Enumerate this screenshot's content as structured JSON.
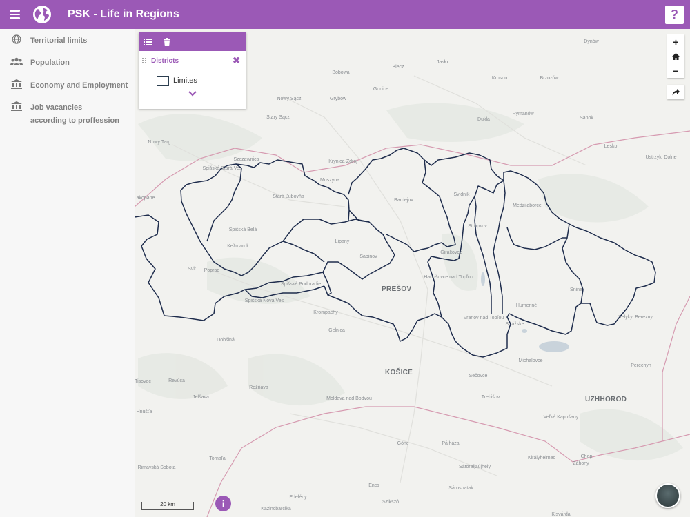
{
  "app": {
    "title": "PSK - Life in Regions",
    "help_label": "?"
  },
  "sidebar": {
    "items": [
      {
        "label": "Territorial limits",
        "icon": "globe-icon"
      },
      {
        "label": "Population",
        "icon": "users-icon"
      },
      {
        "label": "Economy and Employment",
        "icon": "bank-icon"
      },
      {
        "label": "Job vacancies according to proffession",
        "icon": "bank-icon"
      }
    ]
  },
  "layer_panel": {
    "group_title": "Districts",
    "close_label": "✖",
    "layer_label": "Limites",
    "layer_checked": false
  },
  "map": {
    "scale_label": "20 km",
    "info_label": "i",
    "region_names": [
      "PREŠOV",
      "KOŠICE",
      "UZHHOROD"
    ],
    "place_names": [
      "Dynów",
      "Bobowa",
      "Biecz",
      "Jasło",
      "Krosno",
      "Brzozów",
      "Gorlice",
      "Nowy Sącz",
      "Grybów",
      "Rymanów",
      "Stary Sącz",
      "Dukla",
      "Sanok",
      "Nowy Targ",
      "Lesko",
      "Szczawnica",
      "Krynica-Zdrój",
      "Ustrzyki Dolne",
      "Spišská Stará Ves",
      "Muszyna",
      "Stará Ľubovňa",
      "Bardejov",
      "Svidník",
      "Medzilaborce",
      "akopane",
      "Spišská Belá",
      "Stropkov",
      "Kežmarok",
      "Lipany",
      "Giraltovce",
      "Sabinov",
      "Svit",
      "Poprad",
      "Hanušovce nad Topľou",
      "Spišské Podhradie",
      "Snina",
      "Spišská Nová Ves",
      "Humenné",
      "Krompachy",
      "Vranov nad Topľou",
      "Strážske",
      "Velykyi Bereznyi",
      "Gelnica",
      "Dobšiná",
      "Michalovce",
      "Perechyn",
      "Sečovce",
      "Tisovec",
      "Revúca",
      "Rožňava",
      "Trebišov",
      "Jelšava",
      "Moldava nad Bodvou",
      "Hnúšťa",
      "Veľké Kapušany",
      "Gönc",
      "Pálháza",
      "Tornaľa",
      "Királyhelmec",
      "Chop",
      "Záhony",
      "Rimavská Sobota",
      "Sátoraljaújhely",
      "Encs",
      "Sárospatak",
      "Edelény",
      "Szikszó",
      "Kazincbarcika",
      "Kisvárda"
    ]
  },
  "colors": {
    "accent": "#9b59b6",
    "boundary": "#1f2d4d",
    "border": "#d69ab0",
    "water": "#c9d3db"
  }
}
